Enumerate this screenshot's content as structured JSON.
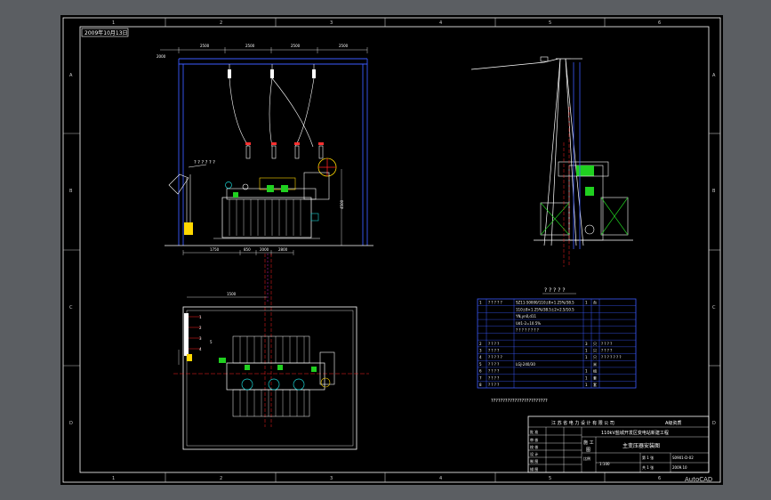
{
  "app": {
    "name": "AutoCAD"
  },
  "drawing": {
    "date_stamp": "2009年10月13日",
    "frame": {
      "col_labels": [
        "1",
        "2",
        "3",
        "4",
        "5",
        "6"
      ],
      "row_labels": [
        "A",
        "B",
        "C",
        "D"
      ]
    },
    "elevation_dimensions": {
      "top": [
        "2000",
        "2500",
        "2500",
        "2500",
        "2500"
      ],
      "bottom": [
        "1750",
        "850",
        "2000",
        "2800"
      ],
      "right_height": "4500",
      "plan_width": "1500"
    },
    "annotations": {
      "arrester_label": "? ? ? ? ? ?",
      "parts_title": "? ? ? ? ?",
      "parts_footnote": "????????????????????????"
    },
    "parts_table": {
      "rows": [
        {
          "no": "1",
          "name": "? ? ? ? ?",
          "spec": "SZ11-50000/110±8×1.25%/38.5",
          "qty": "1",
          "unit": "台",
          "note": ""
        },
        {
          "no": "",
          "name": "",
          "spec": "110±8×1.25%/38.5±2×2.5/10.5",
          "qty": "",
          "unit": "",
          "note": ""
        },
        {
          "no": "",
          "name": "",
          "spec": "YN,yn0,d11",
          "qty": "",
          "unit": "",
          "note": ""
        },
        {
          "no": "",
          "name": "",
          "spec": "Ud1-2=10.5%",
          "qty": "",
          "unit": "",
          "note": ""
        },
        {
          "no": "",
          "name": "",
          "spec": "? ? ? ? ? ? ? ?",
          "qty": "",
          "unit": "",
          "note": ""
        },
        {
          "no": "",
          "name": "",
          "spec": "",
          "qty": "",
          "unit": "",
          "note": ""
        },
        {
          "no": "2",
          "name": "? ? ? ?",
          "spec": "",
          "qty": "3",
          "unit": "只",
          "note": "? ? ? ?"
        },
        {
          "no": "3",
          "name": "? ? ? ?",
          "spec": "",
          "qty": "1",
          "unit": "只",
          "note": "? ? ? ?"
        },
        {
          "no": "4",
          "name": "? ? ? ? ?",
          "spec": "",
          "qty": "1",
          "unit": "只",
          "note": "? ? ? ? ? ? ?"
        },
        {
          "no": "5",
          "name": "? ? ? ?",
          "spec": "LGJ-240/30",
          "qty": "",
          "unit": "米",
          "note": ""
        },
        {
          "no": "6",
          "name": "? ? ? ?",
          "spec": "",
          "qty": "1",
          "unit": "组",
          "note": ""
        },
        {
          "no": "7",
          "name": "? ? ? ?",
          "spec": "",
          "qty": "1",
          "unit": "套",
          "note": ""
        },
        {
          "no": "8",
          "name": "? ? ? ?",
          "spec": "",
          "qty": "1",
          "unit": "套",
          "note": ""
        }
      ]
    },
    "title_block": {
      "company": "江 苏 省 电 力 设 计 有 限 公 司",
      "cert": "A级资质",
      "project": "110kV盐城开发区变电站新建工程",
      "drawing_name": "主变压器安装图",
      "stage_label": "施 工",
      "stage_value": "图",
      "scale_label": "比例",
      "scale_value": "1:100",
      "sheet_label": "第 1 张",
      "sheet_value": "共 1 张",
      "drawing_no": "S0901-D-02",
      "date": "2009.10",
      "role_rows": [
        "批 准",
        "审 核",
        "校 核",
        "设 计",
        "制 图",
        "描 图"
      ]
    },
    "colors": {
      "background": "#5b5e62",
      "sheet": "#000000",
      "frame": "#ffffff",
      "blue": "#3b5bff",
      "red": "#ff2020",
      "green": "#20d020",
      "cyan": "#19d3d3",
      "yellow": "#ffd800",
      "magenta": "#d020d0"
    }
  }
}
